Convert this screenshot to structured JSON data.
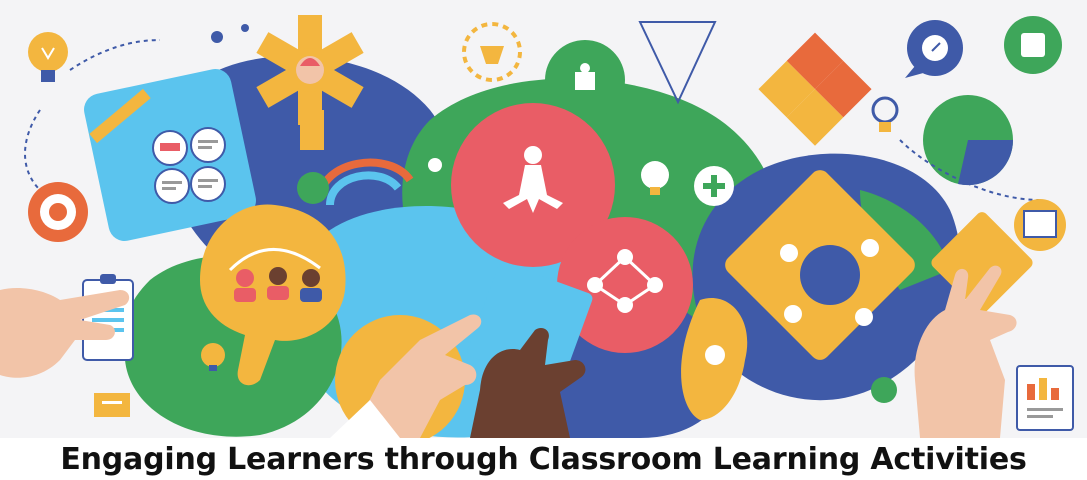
{
  "caption": {
    "text": "Engaging Learners through Classroom Learning Activities"
  },
  "colors": {
    "background": "#f4f4f6",
    "blue": "#3f5aa8",
    "green": "#3ea65a",
    "yellow": "#f3b63f",
    "sky": "#5bc4ee",
    "coral": "#e95d66",
    "orange": "#e86a3c",
    "skin_light": "#f2c4a8",
    "skin_dark": "#6b4030"
  },
  "icons": [
    "lightbulb-icon",
    "gear-icon",
    "puzzle-icon",
    "person-icon",
    "network-icon",
    "plus-icon",
    "speech-bubble-icon",
    "clipboard-icon",
    "pie-chart-icon",
    "heart-icon",
    "target-icon"
  ]
}
